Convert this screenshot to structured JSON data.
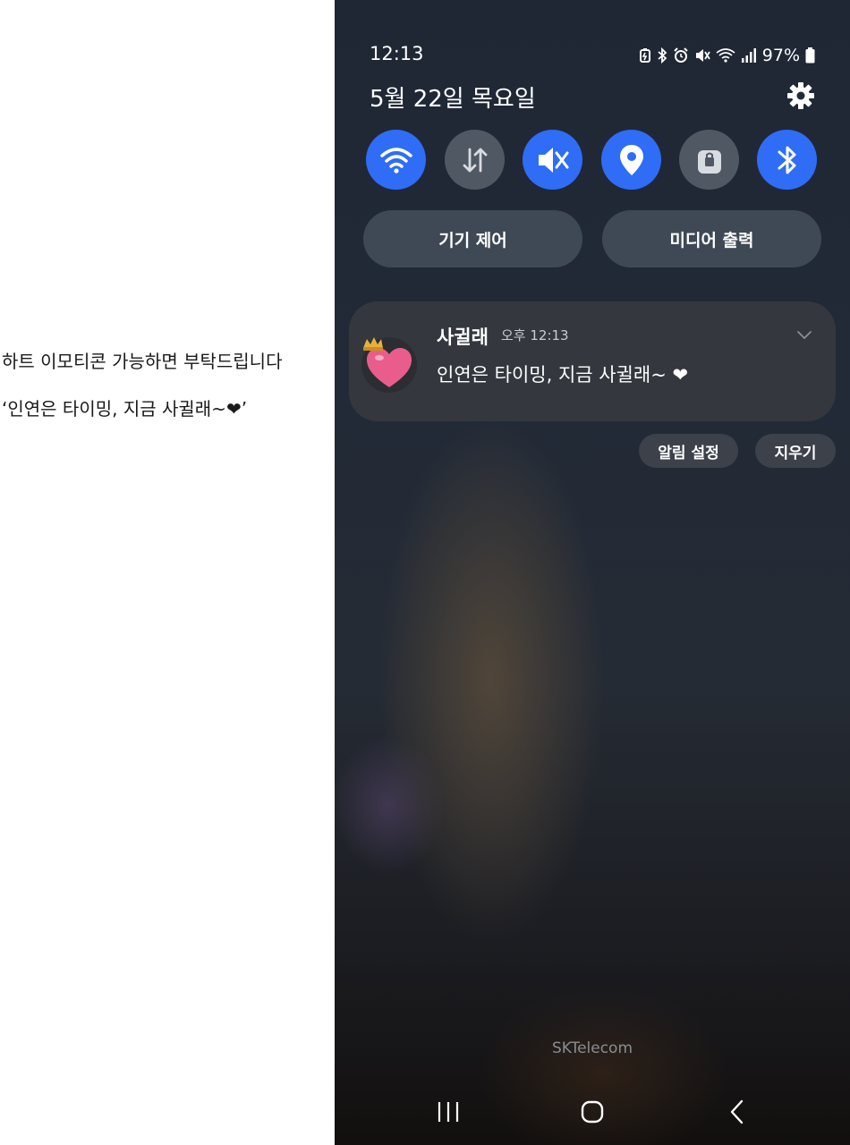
{
  "left_panel": {
    "line1": "하트 이모티콘 가능하면 부탁드립니다",
    "line2": "‘인연은 타이밍, 지금 사귈래~❤’"
  },
  "status_bar": {
    "time": "12:13",
    "battery": "97%",
    "icons": [
      "battery-saver-icon",
      "bluetooth-icon",
      "alarm-icon",
      "mute-icon",
      "wifi-icon",
      "signal-icon",
      "battery-icon"
    ]
  },
  "panel": {
    "date": "5월 22일 목요일"
  },
  "quick_settings": [
    {
      "name": "wifi",
      "icon": "wifi-icon",
      "on": true
    },
    {
      "name": "mobile-data",
      "icon": "data-arrows-icon",
      "on": false
    },
    {
      "name": "sound",
      "icon": "mute-icon",
      "on": true
    },
    {
      "name": "location",
      "icon": "location-pin-icon",
      "on": true
    },
    {
      "name": "secure-folder",
      "icon": "lock-icon",
      "on": false
    },
    {
      "name": "bluetooth",
      "icon": "bluetooth-icon",
      "on": true
    }
  ],
  "pills": {
    "device_control": "기기 제어",
    "media_output": "미디어 출력"
  },
  "notification": {
    "app_name": "사귈래",
    "time": "오후 12:13",
    "message": "인연은 타이밍, 지금 사귈래~ ❤"
  },
  "notification_actions": {
    "settings": "알림 설정",
    "clear": "지우기"
  },
  "carrier": "SKTelecom",
  "colors": {
    "toggle_on": "#2f6df6",
    "toggle_off": "#505864",
    "notification_bg": "#34383e"
  }
}
